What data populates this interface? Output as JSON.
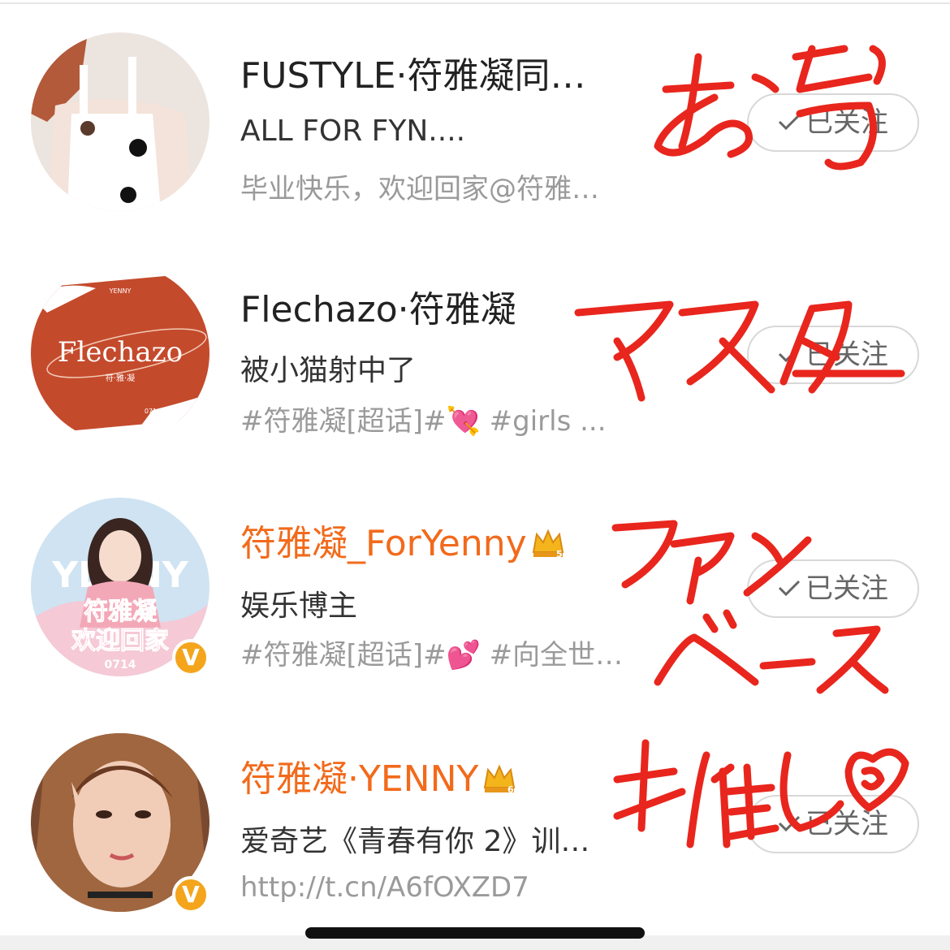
{
  "follow_label": "已关注",
  "rows": [
    {
      "name": "FUSTYLE·符雅凝同…",
      "desc": "ALL FOR FYN....",
      "sub": "毕业快乐，欢迎回家@符雅…",
      "name_color": "#222222",
      "verified": false
    },
    {
      "name": "Flechazo·符雅凝",
      "desc": "被小猫射中了",
      "sub": "#符雅凝[超话]#💘 #girls ...",
      "name_color": "#222222",
      "verified": false,
      "avatar_text": "Flechazo",
      "avatar_subtext": "符·雅·凝",
      "avatar_small": "YENNY",
      "avatar_date": "0714"
    },
    {
      "name": "符雅凝_ForYenny",
      "desc": "娱乐博主",
      "sub": "#符雅凝[超话]#💕 #向全世…",
      "name_color": "#f26a1b",
      "verified": true,
      "avatar_text_1": "符雅凝",
      "avatar_text_2": "欢迎回家",
      "avatar_date": "0714",
      "avatar_bg_text": "YENNY",
      "crown_level": "5"
    },
    {
      "name": "符雅凝·YENNY",
      "desc": "爱奇艺《青春有你 2》训…",
      "sub": "http://t.cn/A6fOXZD7",
      "name_color": "#f26a1b",
      "verified": true,
      "crown_level": "6"
    }
  ],
  "verified_badge": "V",
  "handwriting": [
    "お気",
    "マスター",
    "ファン",
    "ベース",
    "推し"
  ],
  "colors": {
    "accent_orange": "#f26a1b",
    "verified_yellow": "#f4a51c",
    "scribble_red": "#e8261d"
  }
}
